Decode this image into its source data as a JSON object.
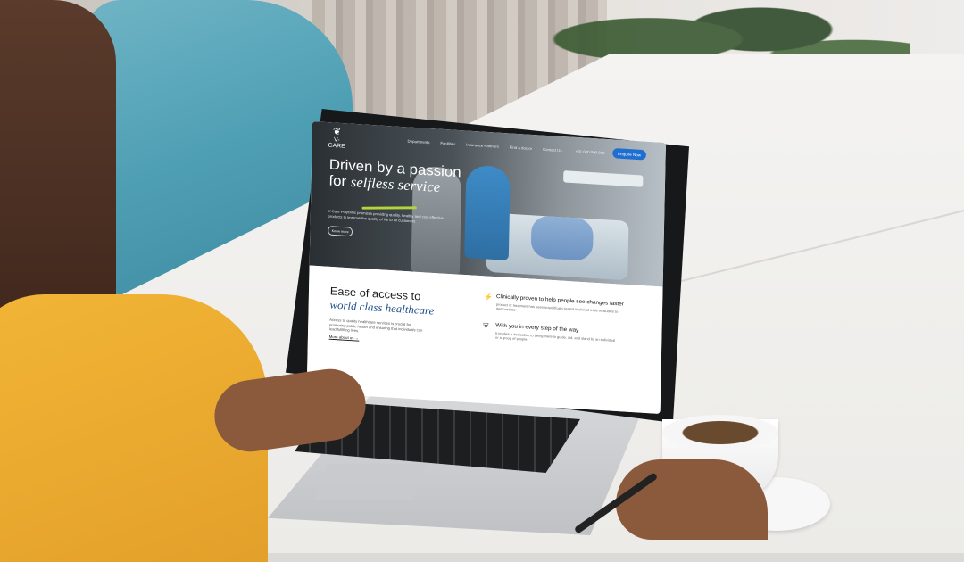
{
  "site": {
    "logo_text": "V-CARE",
    "nav": [
      "Departments",
      "Facilities",
      "Insurance Partners",
      "Find a doctor",
      "Contact Us"
    ],
    "phone": "+91 000 000 000",
    "enquire_label": "Enquire Now",
    "hero": {
      "title_line1": "Driven by a passion",
      "title_line2_prefix": "for",
      "title_line2_accent": "selfless service",
      "description": "V-Care Polyclinic promises providing quality, healthy and cost effective products to improve the quality of life to all customers",
      "button_label": "Know more"
    },
    "lower": {
      "title": "Ease of access to",
      "title_accent": "world class healthcare",
      "description": "Access to quality healthcare services is crucial for promoting public health and ensuring that individuals can lead fulfilling lives.",
      "link_label": "More about us →"
    },
    "features": [
      {
        "icon": "lightning-icon",
        "title": "Clinically proven to help people see changes faster",
        "description": "product or treatment has been scientifically tested in clinical trials or studies to demonstrate"
      },
      {
        "icon": "shield-icon",
        "title": "With you in every step of the way",
        "description": "It implies a dedication to being there to guide, aid, and stand by an individual or a group of people"
      }
    ]
  },
  "colors": {
    "accent_blue": "#1f6fd1",
    "accent_text": "#1f4f8a",
    "swash": "#b6d43a"
  }
}
